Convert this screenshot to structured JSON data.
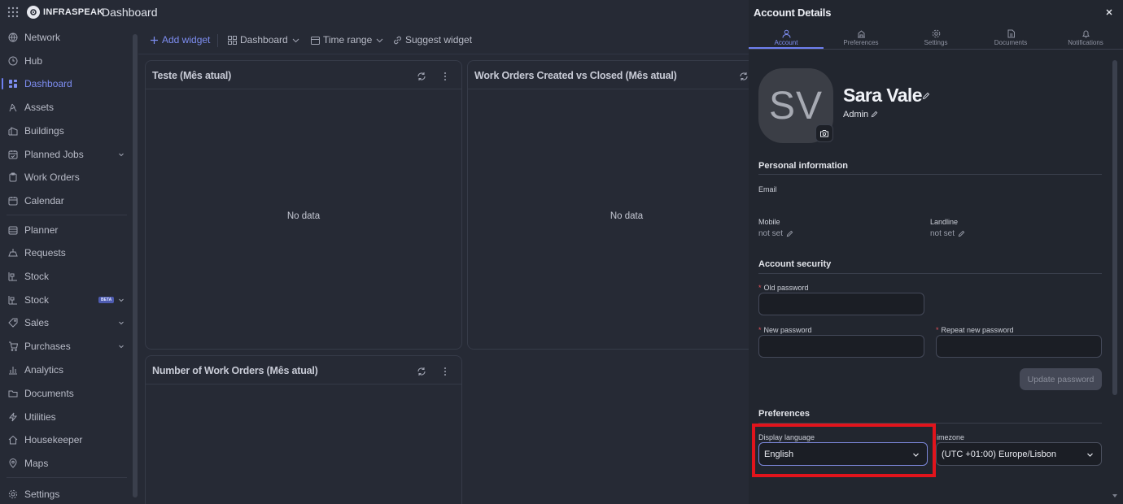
{
  "header": {
    "logo_text": "INFRASPEAK",
    "title": "Dashboard"
  },
  "sidebar": {
    "items": [
      {
        "label": "Network",
        "icon": "globe-icon"
      },
      {
        "label": "Hub",
        "icon": "clock-icon"
      },
      {
        "label": "Dashboard",
        "icon": "dashboard-icon",
        "active": true
      },
      {
        "label": "Assets",
        "icon": "assets-icon"
      },
      {
        "label": "Buildings",
        "icon": "building-icon"
      },
      {
        "label": "Planned Jobs",
        "icon": "calendar-check-icon",
        "has_submenu": true
      },
      {
        "label": "Work Orders",
        "icon": "clipboard-icon"
      },
      {
        "label": "Calendar",
        "icon": "calendar-icon"
      },
      {
        "label": "Planner",
        "icon": "planner-icon"
      },
      {
        "label": "Requests",
        "icon": "requests-icon"
      },
      {
        "label": "Stock",
        "icon": "stock-icon"
      },
      {
        "label": "Stock",
        "icon": "stock-icon",
        "badge": "BETA",
        "has_submenu": true
      },
      {
        "label": "Sales",
        "icon": "tag-icon",
        "has_submenu": true
      },
      {
        "label": "Purchases",
        "icon": "cart-icon",
        "has_submenu": true
      },
      {
        "label": "Analytics",
        "icon": "analytics-icon"
      },
      {
        "label": "Documents",
        "icon": "folder-icon"
      },
      {
        "label": "Utilities",
        "icon": "bolt-icon"
      },
      {
        "label": "Housekeeper",
        "icon": "house-icon"
      },
      {
        "label": "Maps",
        "icon": "map-pin-icon"
      },
      {
        "label": "Settings",
        "icon": "gear-icon"
      }
    ]
  },
  "toolbar": {
    "add_widget": "Add widget",
    "dashboard": "Dashboard",
    "time_range": "Time range",
    "suggest_widget": "Suggest widget"
  },
  "widgets": [
    {
      "title": "Teste (Mês atual)",
      "empty_text": "No data"
    },
    {
      "title": "Work Orders Created vs Closed (Mês atual)",
      "empty_text": "No data"
    },
    {
      "title": "Number of Work Orders (Mês atual)",
      "empty_text": ""
    }
  ],
  "panel": {
    "title": "Account Details",
    "tabs": [
      {
        "label": "Account",
        "icon": "user-icon",
        "active": true
      },
      {
        "label": "Preferences",
        "icon": "preferences-icon"
      },
      {
        "label": "Settings",
        "icon": "gear-icon"
      },
      {
        "label": "Documents",
        "icon": "document-icon"
      },
      {
        "label": "Notifications",
        "icon": "bell-icon"
      }
    ],
    "avatar_initials": "SV",
    "user_name": "Sara Vale",
    "user_role": "Admin",
    "personal_info": {
      "title": "Personal information",
      "email_label": "Email",
      "mobile_label": "Mobile",
      "mobile_value": "not set",
      "landline_label": "Landline",
      "landline_value": "not set"
    },
    "security": {
      "title": "Account security",
      "old_password_label": "Old password",
      "new_password_label": "New password",
      "repeat_password_label": "Repeat new password",
      "update_button": "Update password"
    },
    "preferences": {
      "title": "Preferences",
      "language_label": "Display language",
      "language_value": "English",
      "timezone_label": "imezone",
      "timezone_value": "(UTC +01:00) Europe/Lisbon"
    }
  },
  "colors": {
    "accent": "#6e7ff0",
    "highlight": "#e1141c",
    "background": "#262a35",
    "panel": "#22262f"
  }
}
